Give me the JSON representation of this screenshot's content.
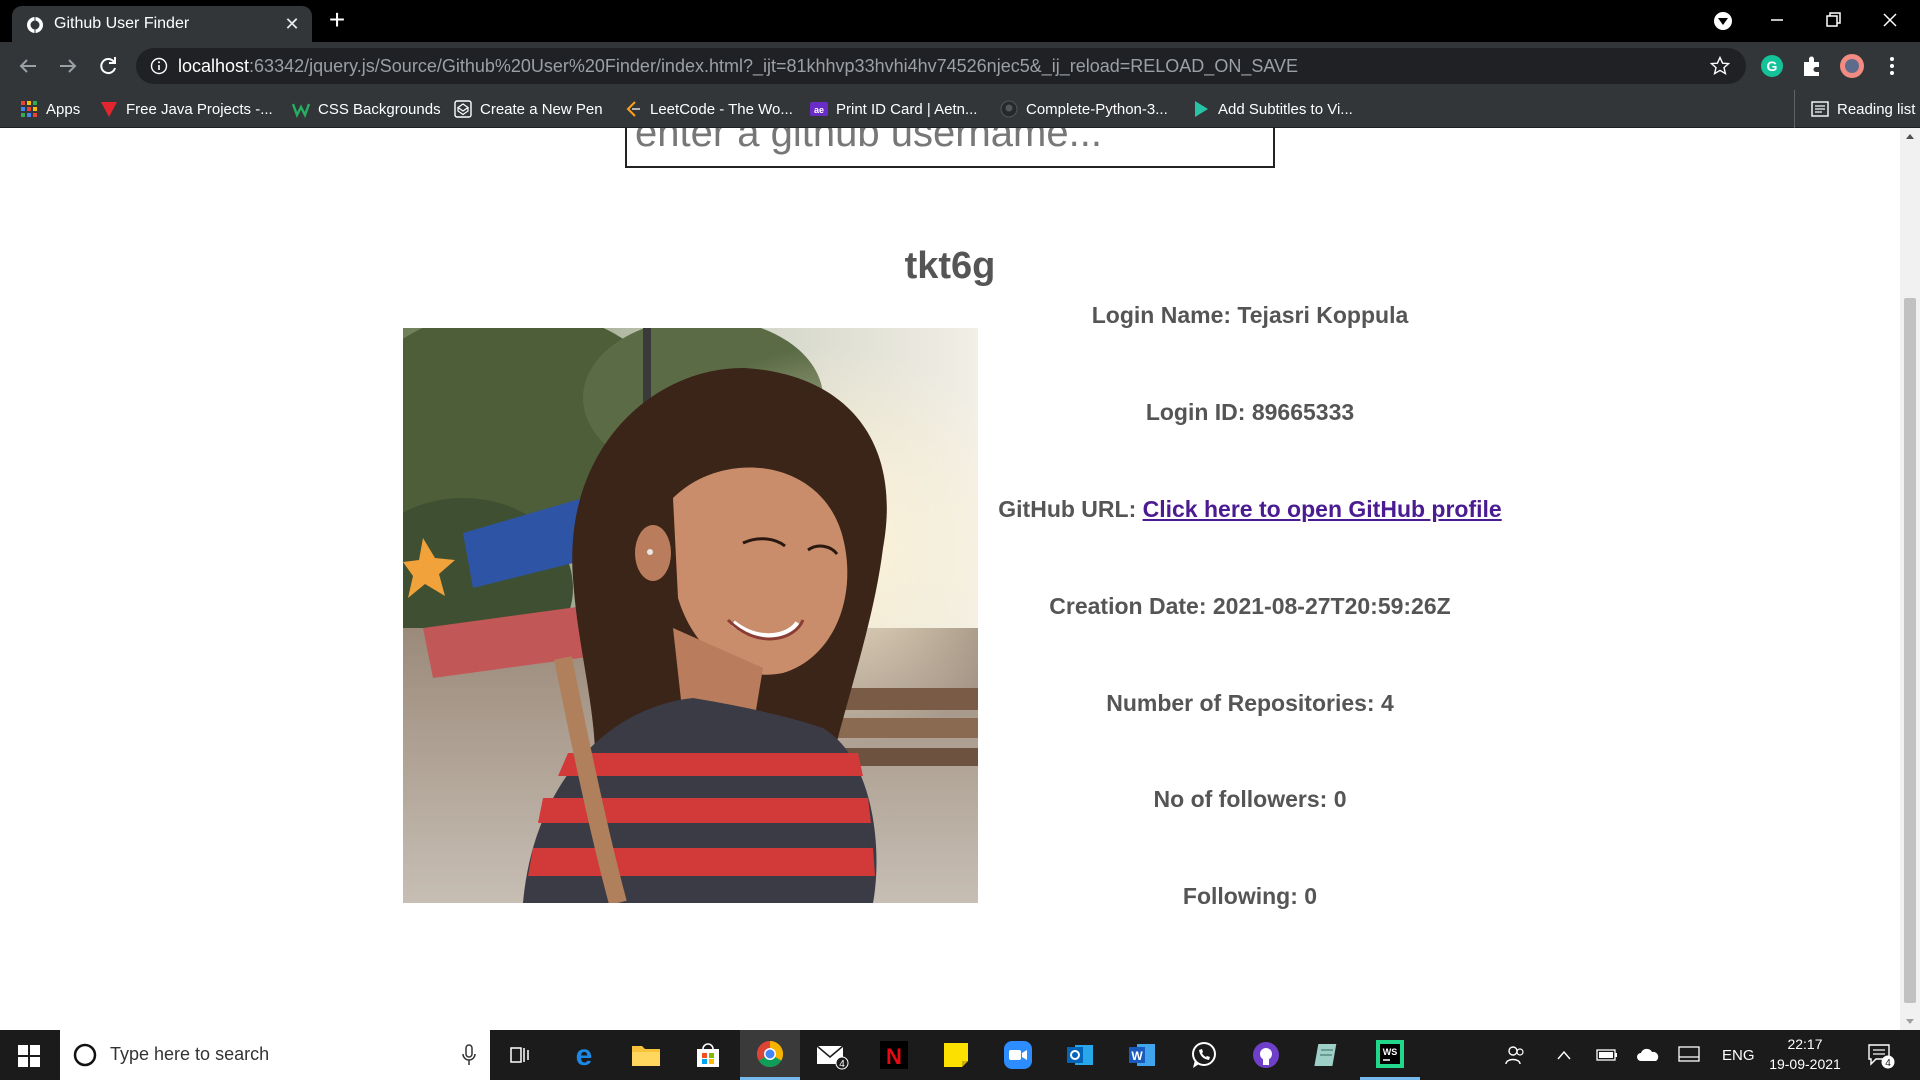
{
  "browser": {
    "tab": {
      "title": "Github User Finder",
      "close_icon": "close-icon",
      "new_tab_icon": "plus-icon"
    },
    "address": {
      "host": "localhost",
      "rest": ":63342/jquery.js/Source/Github%20User%20Finder/index.html?_ijt=81khhvp33hvhi4hv74526njec5&_ij_reload=RELOAD_ON_SAVE"
    },
    "bookmarks": [
      {
        "label": "Apps",
        "icon": "apps-grid-icon"
      },
      {
        "label": "Free Java Projects -...",
        "icon": "red-v-icon"
      },
      {
        "label": "CSS Backgrounds",
        "icon": "green-w-icon"
      },
      {
        "label": "Create a New Pen",
        "icon": "codepen-icon"
      },
      {
        "label": "LeetCode - The Wo...",
        "icon": "leetcode-icon"
      },
      {
        "label": "Print ID Card | Aetn...",
        "icon": "id-card-icon"
      },
      {
        "label": "Complete-Python-3...",
        "icon": "github-icon"
      },
      {
        "label": "Add Subtitles to Vi...",
        "icon": "play-icon"
      }
    ],
    "reading_list": "Reading list"
  },
  "page": {
    "search": {
      "placeholder": "enter a github username..."
    },
    "username": "tkt6g",
    "info": {
      "login_name_label": "Login Name:",
      "login_name_value": "Tejasri Koppula",
      "login_id_label": "Login ID:",
      "login_id_value": "89665333",
      "github_url_label": "GitHub URL:",
      "github_url_link": "Click here to open GitHub profile",
      "creation_date_label": "Creation Date:",
      "creation_date_value": "2021-08-27T20:59:26Z",
      "repos_label": "Number of Repositories:",
      "repos_value": "4",
      "followers_label": "No of followers:",
      "followers_value": "0",
      "following_label": "Following:",
      "following_value": "0"
    }
  },
  "taskbar": {
    "search_placeholder": "Type here to search",
    "mail_badge": "4",
    "language": "ENG",
    "time": "22:17",
    "date": "19-09-2021",
    "notification_count": "4"
  },
  "colors": {
    "text_gray": "#555555",
    "link_visited": "#4b1c91",
    "chrome_dark": "#323639"
  }
}
